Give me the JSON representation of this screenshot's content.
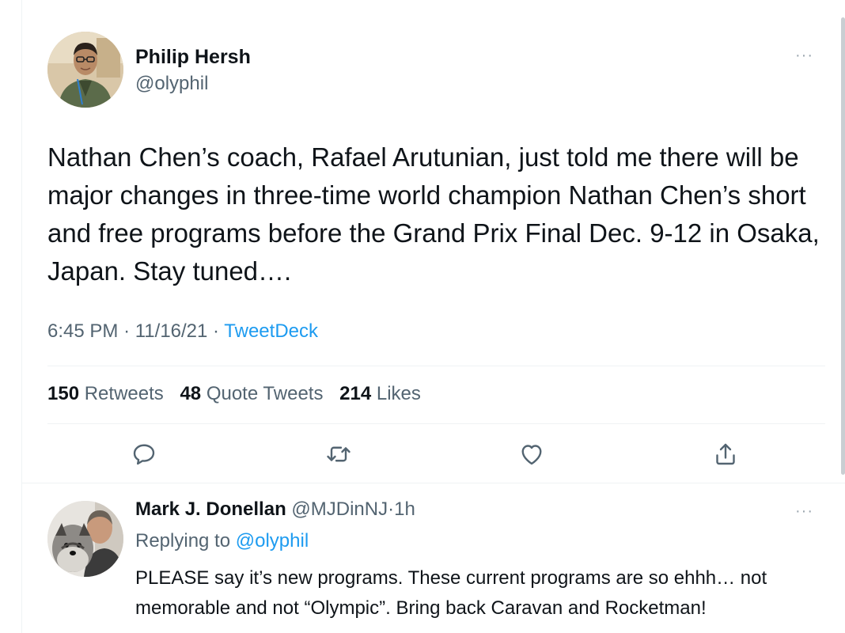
{
  "main_tweet": {
    "author_name": "Philip Hersh",
    "author_handle": "@olyphil",
    "more_label": "···",
    "text": "Nathan Chen’s coach, Rafael Arutunian, just told me there will be major changes in three-time world champion Nathan Chen’s short and free programs before the Grand Prix Final Dec. 9-12 in Osaka, Japan.  Stay tuned….",
    "time": "6:45 PM",
    "date": "11/16/21",
    "separator": "·",
    "source": "TweetDeck",
    "stats": {
      "retweets_count": "150",
      "retweets_label": "Retweets",
      "quotes_count": "48",
      "quotes_label": "Quote Tweets",
      "likes_count": "214",
      "likes_label": "Likes"
    },
    "actions": [
      "reply-icon",
      "retweet-icon",
      "like-icon",
      "share-icon"
    ]
  },
  "reply": {
    "author_name": "Mark J. Donellan",
    "author_handle": "@MJDinNJ",
    "separator": "·",
    "time_ago": "1h",
    "replying_label": "Replying to",
    "replying_to": "@olyphil",
    "more_label": "···",
    "text": "PLEASE say it’s new programs.  These current programs are so ehhh… not memorable and not “Olympic”.   Bring back Caravan and Rocketman!"
  },
  "colors": {
    "text_primary": "#0f1419",
    "text_secondary": "#536471",
    "link": "#1d9bf0",
    "icon": "#536471",
    "divider": "#eff3f4"
  }
}
